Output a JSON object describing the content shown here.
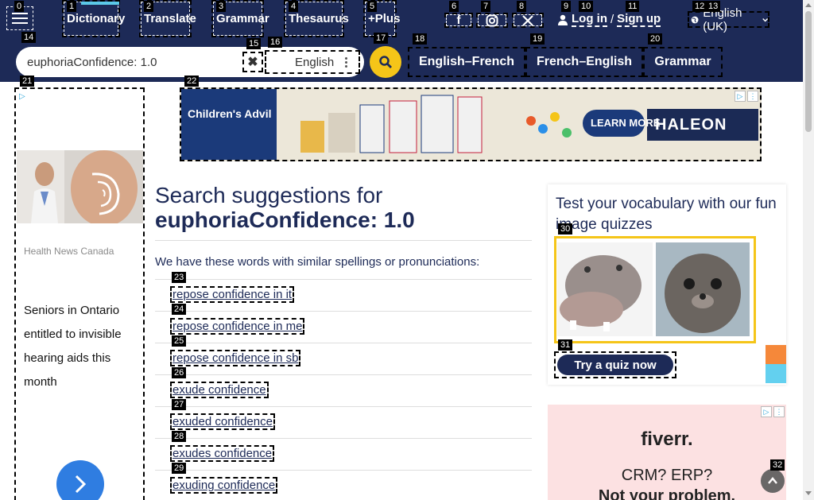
{
  "header": {
    "nav": [
      {
        "label": "Dictionary",
        "badge": "1",
        "active": true
      },
      {
        "label": "Translate",
        "badge": "2"
      },
      {
        "label": "Grammar",
        "badge": "3"
      },
      {
        "label": "Thesaurus",
        "badge": "4"
      },
      {
        "label": "+Plus",
        "badge": "5"
      }
    ],
    "menu_badge": "0",
    "social": [
      {
        "icon": "facebook-icon",
        "glyph": "f",
        "badge": "6"
      },
      {
        "icon": "instagram-icon",
        "glyph": "◎",
        "badge": "7"
      },
      {
        "icon": "x-icon",
        "glyph": "𝕏",
        "badge": "8"
      }
    ],
    "login": {
      "login_label": "Log in",
      "sep": "/",
      "signup_label": "Sign up",
      "badge_user": "9",
      "badge_login": "10",
      "badge_signup": "11"
    },
    "language": {
      "label": "English (UK)",
      "badge_a": "12",
      "badge_b": "13"
    }
  },
  "search": {
    "value": "euphoriaConfidence: 1.0",
    "input_badge": "14",
    "clear_badge": "15",
    "dictionary_label": "English",
    "dictionary_badge": "16",
    "search_badge": "17",
    "quick_links": [
      {
        "label": "English–French",
        "badge": "18"
      },
      {
        "label": "French–English",
        "badge": "19"
      },
      {
        "label": "Grammar",
        "badge": "20"
      }
    ]
  },
  "left_ad": {
    "badge": "21",
    "source": "Health News Canada",
    "text": "Seniors in Ontario entitled to invisible hearing aids this month"
  },
  "banner_ad": {
    "badge": "22",
    "brand_left": "Children's Advil",
    "cta": "LEARN MORE",
    "brand_right": "HALEON"
  },
  "main": {
    "title_prefix": "Search suggestions for",
    "title_query": "euphoriaConfidence: 1.0",
    "intro": "We have these words with similar spellings or pronunciations:",
    "suggestions": [
      {
        "label": "repose confidence in it",
        "badge": "23"
      },
      {
        "label": "repose confidence in me",
        "badge": "24"
      },
      {
        "label": "repose confidence in sb",
        "badge": "25"
      },
      {
        "label": "exude confidence",
        "badge": "26"
      },
      {
        "label": "exuded confidence",
        "badge": "27"
      },
      {
        "label": "exudes confidence",
        "badge": "28"
      },
      {
        "label": "exuding confidence",
        "badge": "29"
      }
    ]
  },
  "quiz": {
    "title": "Test your vocabulary with our fun image quizzes",
    "images_badge": "30",
    "button_label": "Try a quiz now",
    "button_badge": "31"
  },
  "fiverr_ad": {
    "logo": "fiverr.",
    "line1": "CRM? ERP?",
    "line2": "Not your problem."
  },
  "back_to_top_badge": "32"
}
